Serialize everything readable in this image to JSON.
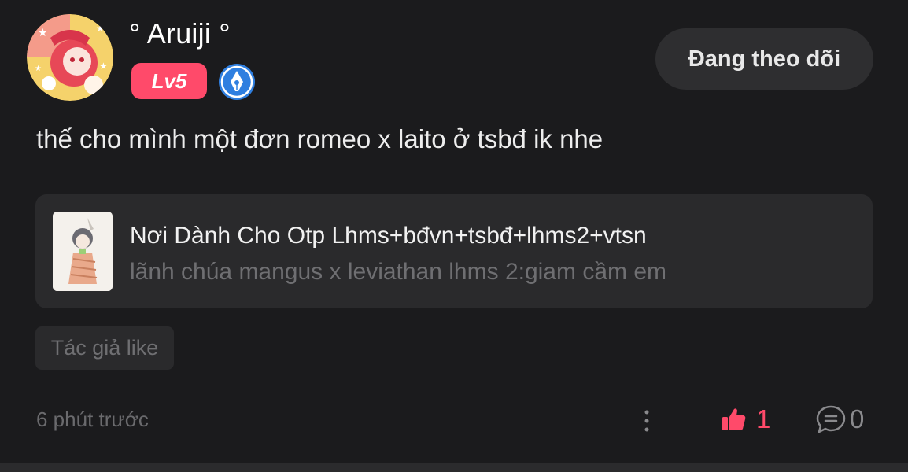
{
  "post": {
    "username": "° Aruiji °",
    "level": "Lv5",
    "follow_label": "Đang theo dõi",
    "content": "thế cho mình một đơn romeo x laito ở tsbđ ik nhe",
    "tag": "Tác giả like",
    "time": "6 phút trước",
    "like_count": "1",
    "comment_count": "0"
  },
  "card": {
    "title": "Nơi Dành Cho Otp Lhms+bđvn+tsbđ+lhms2+vtsn",
    "subtitle": "lãnh chúa mangus x leviathan lhms 2:giam cầm em"
  },
  "icons": {
    "badge": "pen-badge-icon",
    "more": "more-vertical-icon",
    "like": "thumbs-up-icon",
    "comment": "comment-bubble-icon"
  },
  "colors": {
    "accent": "#ff4a6a",
    "background": "#1b1b1d",
    "card": "#2a2a2c",
    "badge_blue": "#3b8fe8"
  }
}
